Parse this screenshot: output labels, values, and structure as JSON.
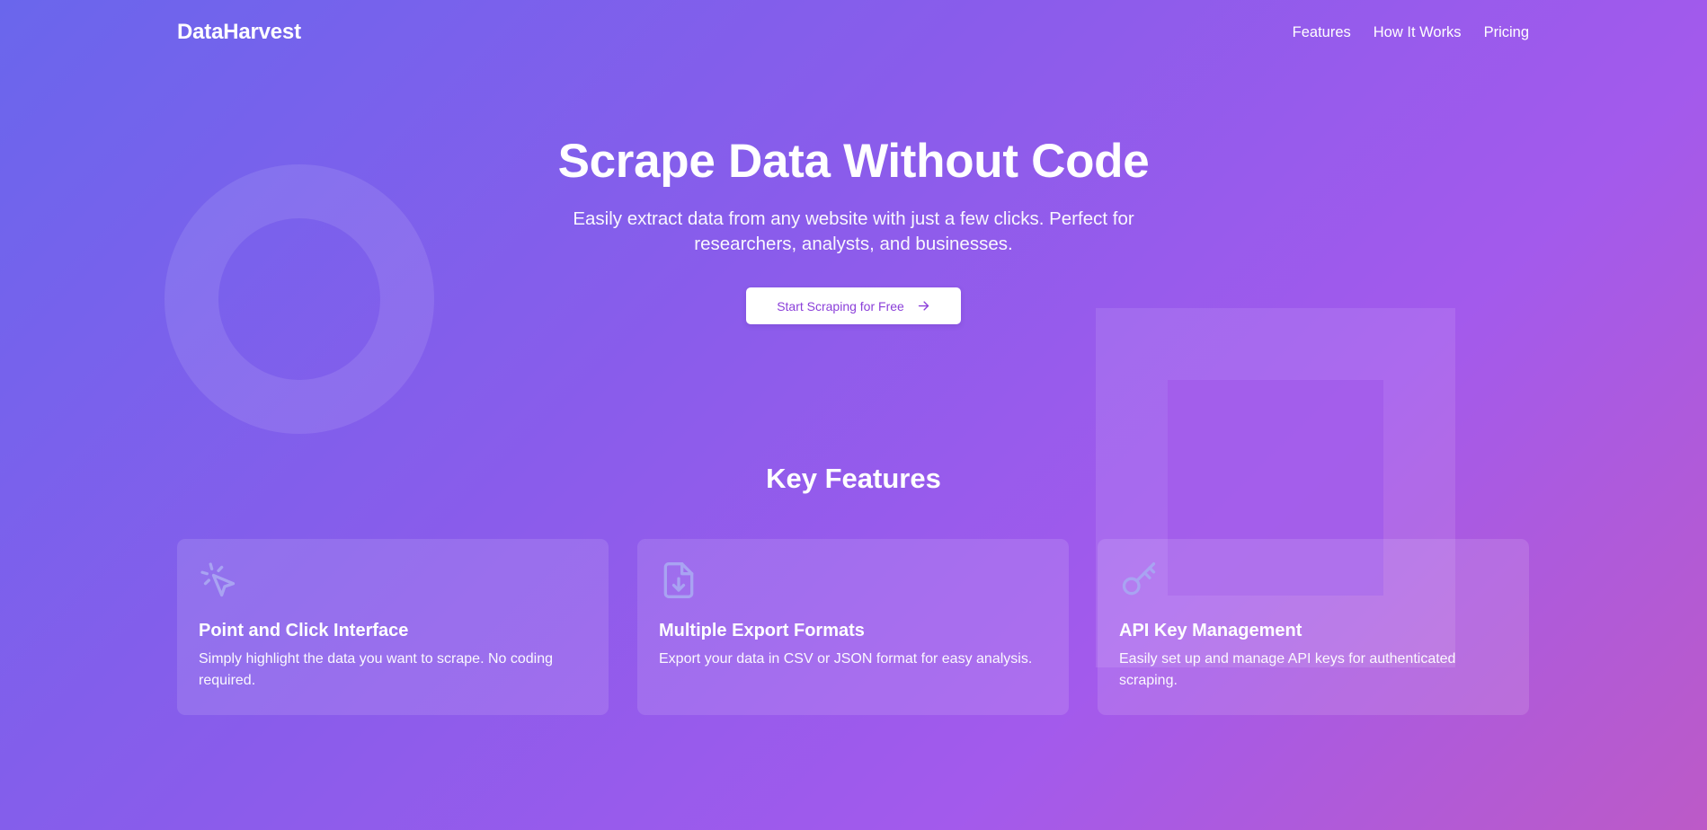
{
  "brand": "DataHarvest",
  "nav": {
    "items": [
      {
        "label": "Features"
      },
      {
        "label": "How It Works"
      },
      {
        "label": "Pricing"
      }
    ]
  },
  "hero": {
    "title": "Scrape Data Without Code",
    "subtitle": "Easily extract data from any website with just a few clicks. Perfect for researchers, analysts, and businesses.",
    "cta_label": "Start Scraping for Free",
    "cta_icon": "arrow-right-icon"
  },
  "features": {
    "title": "Key Features",
    "items": [
      {
        "icon": "pointer-click-icon",
        "title": "Point and Click Interface",
        "desc": "Simply highlight the data you want to scrape. No coding required."
      },
      {
        "icon": "file-download-icon",
        "title": "Multiple Export Formats",
        "desc": "Export your data in CSV or JSON format for easy analysis."
      },
      {
        "icon": "key-icon",
        "title": "API Key Management",
        "desc": "Easily set up and manage API keys for authenticated scraping."
      }
    ]
  },
  "colors": {
    "gradient_start": "#6a66ec",
    "gradient_end": "#bc5ac7",
    "cta_text": "#8b3fd9",
    "icon_color": "#a9a3f2"
  }
}
